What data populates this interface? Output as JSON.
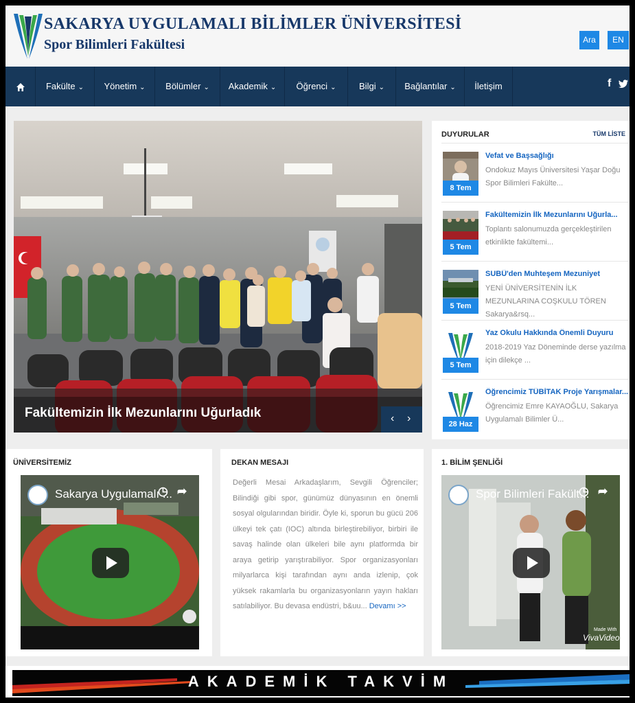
{
  "header": {
    "university": "SAKARYA UYGULAMALI BİLİMLER ÜNİVERSİTESİ",
    "faculty": "Spor Bilimleri Fakültesi",
    "search_label": "Ara",
    "lang_label": "EN",
    "brand_color": "#17386a"
  },
  "nav": {
    "home_icon": "home-icon",
    "items": [
      {
        "label": "Fakülte",
        "has_menu": true
      },
      {
        "label": "Yönetim",
        "has_menu": true
      },
      {
        "label": "Bölümler",
        "has_menu": true
      },
      {
        "label": "Akademik",
        "has_menu": true
      },
      {
        "label": "Öğrenci",
        "has_menu": true
      },
      {
        "label": "Bilgi",
        "has_menu": true
      },
      {
        "label": "Bağlantılar",
        "has_menu": true
      },
      {
        "label": "İletişim",
        "has_menu": false
      }
    ],
    "chevron": "⌄",
    "social": {
      "facebook": "f",
      "twitter": "twitter-icon"
    },
    "background": "#17385a"
  },
  "slider": {
    "caption": "Fakültemizin İlk Mezunlarını Uğurladık",
    "prev": "‹",
    "next": "›"
  },
  "announcements": {
    "title": "DUYURULAR",
    "all_link": "TÜM LİSTE",
    "items": [
      {
        "date": "8 Tem",
        "title": "Vefat ve Başsağlığı",
        "summary": "Ondokuz Mayıs Üniversitesi Yaşar Doğu Spor Bilimleri Fakülte..."
      },
      {
        "date": "5 Tem",
        "title": "Fakültemizin İlk Mezunlarını Uğurla...",
        "summary": "Toplantı salonumuzda gerçekleştirilen etkinlikte fakültemi..."
      },
      {
        "date": "5 Tem",
        "title": "SUBÜ'den Muhteşem Mezuniyet",
        "summary": "YENİ ÜNİVERSİTENİN İLK MEZUNLARINA COŞKULU TÖREN Sakarya&rsq..."
      },
      {
        "date": "5 Tem",
        "title": "Yaz Okulu Hakkında Önemli Duyuru",
        "summary": "2018-2019 Yaz Döneminde derse yazılma için dilekçe ..."
      },
      {
        "date": "28 Haz",
        "title": "Öğrencimiz TÜBİTAK Proje Yarışmalar...",
        "summary": "Öğrencimiz Emre KAYAOĞLU, Sakarya Uygulamalı Bilimler Ü..."
      }
    ],
    "date_color": "#1e88e5"
  },
  "cards": {
    "university": {
      "title": "ÜNİVERSİTEMİZ",
      "video_title": "Sakarya Uygulamalı ..."
    },
    "dean": {
      "title": "DEKAN MESAJI",
      "text": "Değerli Mesai Arkadaşlarım, Sevgili Öğrenciler; Bilindiği gibi spor, günümüz dünyasının en önemli sosyal olgularından biridir. Öyle ki, sporun bu gücü 206 ülkeyi tek çatı (IOC) altında birleştirebiliyor, birbiri ile savaş halinde olan ülkeleri bile aynı platformda bir araya getirip yarıştırabiliyor. Spor organizasyonları milyarlarca kişi tarafından aynı anda izlenip, çok yüksek rakamlarla bu organizasyonların yayın hakları satılabiliyor. Bu devasa endüstri, b&uu...",
      "more": "Devamı >>"
    },
    "festival": {
      "title": "1. BİLİM ŞENLİĞİ",
      "video_title": "Spor Bilimleri Fakült...",
      "watermark_top": "Made With",
      "watermark_bottom": "VivaVideo"
    }
  },
  "banner": {
    "text": "AKADEMİK TAKVİM"
  }
}
